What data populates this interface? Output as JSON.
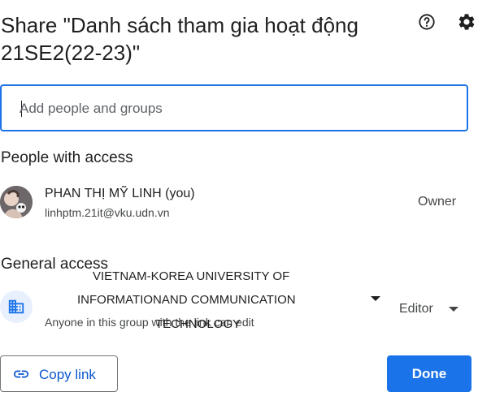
{
  "dialog": {
    "title": "Share \"Danh sách tham gia hoạt động 21SE2(22-23)\""
  },
  "search": {
    "placeholder": "Add people and groups"
  },
  "people_section": {
    "heading": "People with access",
    "person": {
      "name": "PHAN THỊ MỸ LINH (you)",
      "email": "linhptm.21it@vku.udn.vn",
      "role": "Owner"
    }
  },
  "general_access": {
    "heading": "General access",
    "organization_lines": [
      "VIETNAM-KOREA UNIVERSITY OF",
      "INFORMATIONAND COMMUNICATION",
      "TECHNOLOGY"
    ],
    "description": "Anyone in this group with the link can edit",
    "role": "Editor"
  },
  "footer": {
    "copy_link_label": "Copy link",
    "done_label": "Done"
  },
  "colors": {
    "accent": "#1a73e8",
    "link": "#0b57d0",
    "icon_bg": "#e8f0fe"
  },
  "icons": {
    "help": "help-circle-icon",
    "settings": "gear-icon",
    "organization": "building-icon",
    "link": "link-icon"
  }
}
